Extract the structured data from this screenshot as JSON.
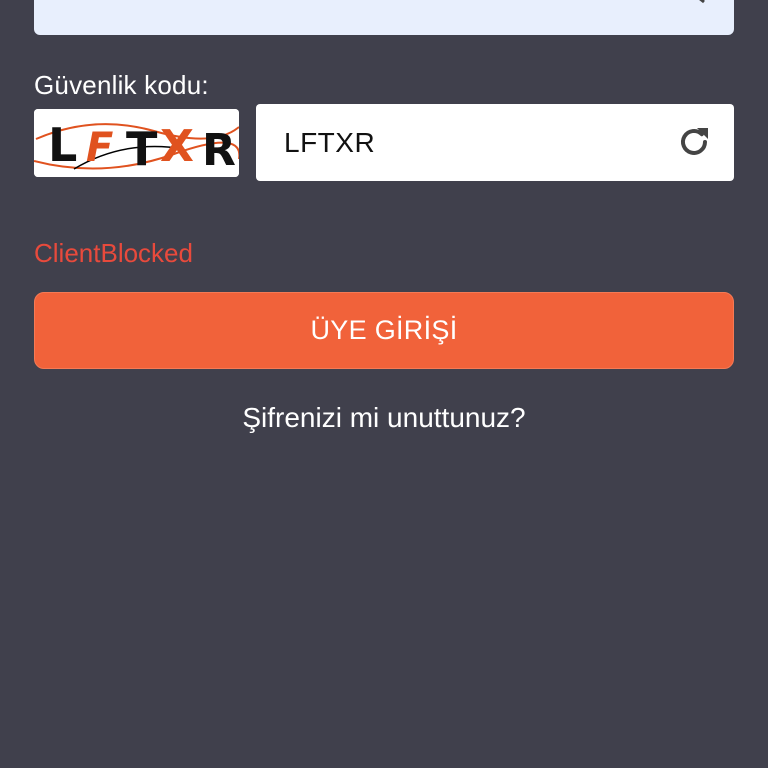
{
  "password": {
    "toggle_icon": "eye-slash-icon"
  },
  "captcha": {
    "label": "Güvenlik kodu:",
    "image_text": "LFTXR",
    "input_value": "LFTXR",
    "refresh_icon": "refresh-icon"
  },
  "error": {
    "message": "ClientBlocked",
    "color": "#e84a3c"
  },
  "login_button": {
    "label": "ÜYE GİRİŞİ",
    "color": "#f1623a"
  },
  "forgot_password": {
    "label": "Şifrenizi mi unuttunuz?"
  },
  "colors": {
    "background": "#40404c",
    "field_background": "#e8effd"
  }
}
